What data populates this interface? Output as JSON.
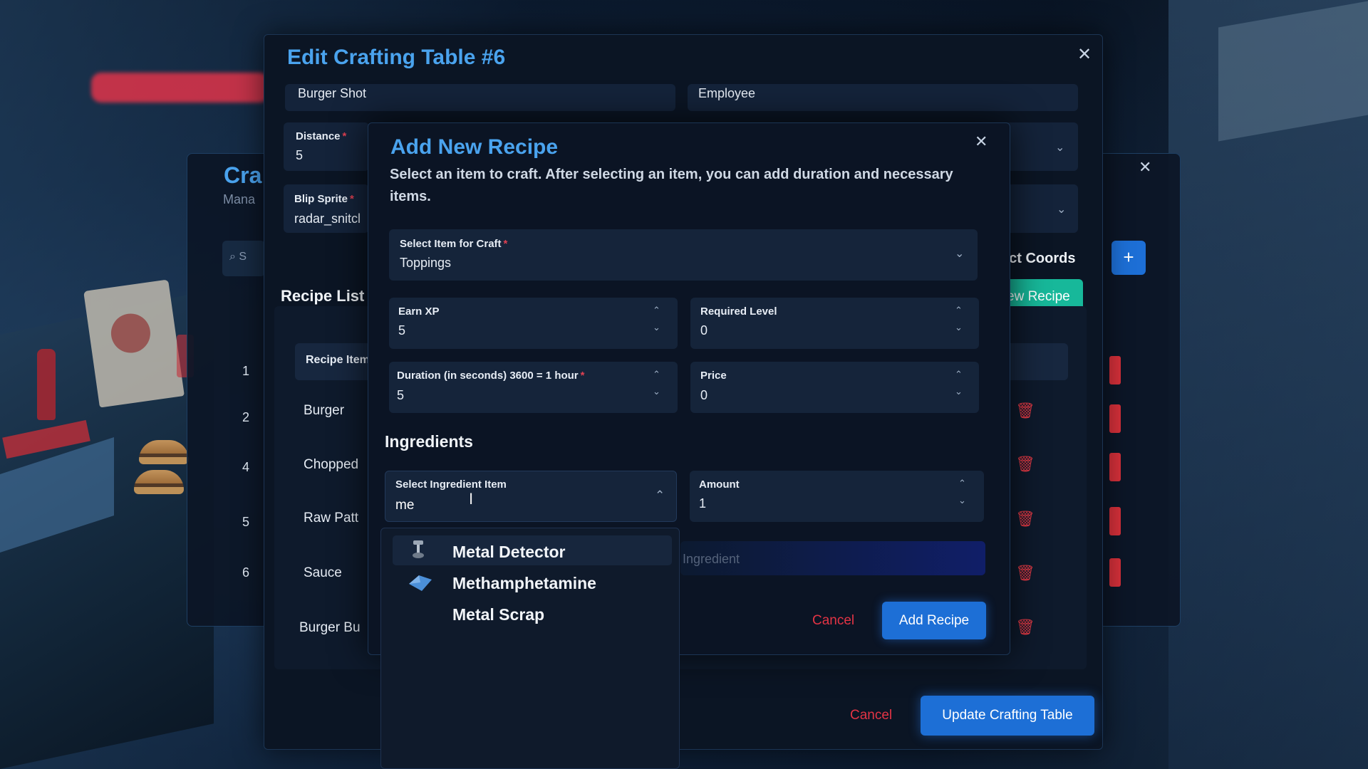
{
  "edit_modal": {
    "title": "Edit Crafting Table #6",
    "job_value": "Burger Shot",
    "grade_value": "Employee",
    "distance_label": "Distance",
    "distance_value": "5",
    "blip_label": "Blip Sprite",
    "blip_value": "radar_snitcl",
    "coords_label": "ect Coords",
    "new_recipe_label": "ew Recipe",
    "recipe_list_title": "Recipe List",
    "recipe_header": "Recipe Item",
    "rows": [
      {
        "num": "1",
        "name": ""
      },
      {
        "num": "2",
        "name": "Burger"
      },
      {
        "num": "4",
        "name": "Chopped"
      },
      {
        "num": "5",
        "name": "Raw Patt"
      },
      {
        "num": "6",
        "name": "Sauce"
      },
      {
        "num": "",
        "name": "Burger Bu"
      }
    ],
    "cancel_label": "Cancel",
    "update_label": "Update Crafting Table"
  },
  "bg_modal": {
    "title": "Cra",
    "subtitle": "Mana",
    "search_placeholder": "S"
  },
  "recipe_modal": {
    "title": "Add New Recipe",
    "description": "Select an item to craft. After selecting an item, you can add duration and necessary items.",
    "select_item_label": "Select Item for Craft",
    "select_item_value": "Toppings",
    "earn_xp_label": "Earn XP",
    "earn_xp_value": "5",
    "required_level_label": "Required Level",
    "required_level_value": "0",
    "duration_label": "Duration (in seconds) 3600 = 1 hour",
    "duration_value": "5",
    "price_label": "Price",
    "price_value": "0",
    "ingredients_title": "Ingredients",
    "ingredient_label": "Select Ingredient Item",
    "ingredient_search_value": "me",
    "amount_label": "Amount",
    "amount_value": "1",
    "add_ingredient_label": "Ingredient",
    "cancel_label": "Cancel",
    "add_recipe_label": "Add Recipe"
  },
  "dropdown": {
    "items": [
      {
        "label": "Metal Detector",
        "icon": "metal-detector-icon"
      },
      {
        "label": "Methamphetamine",
        "icon": "meth-crystal-icon"
      },
      {
        "label": "Metal Scrap",
        "icon": ""
      }
    ]
  },
  "colors": {
    "accent_blue": "#4aa3ee",
    "button_blue": "#1d6fd6",
    "danger_red": "#e33445",
    "teal": "#17b89a"
  }
}
